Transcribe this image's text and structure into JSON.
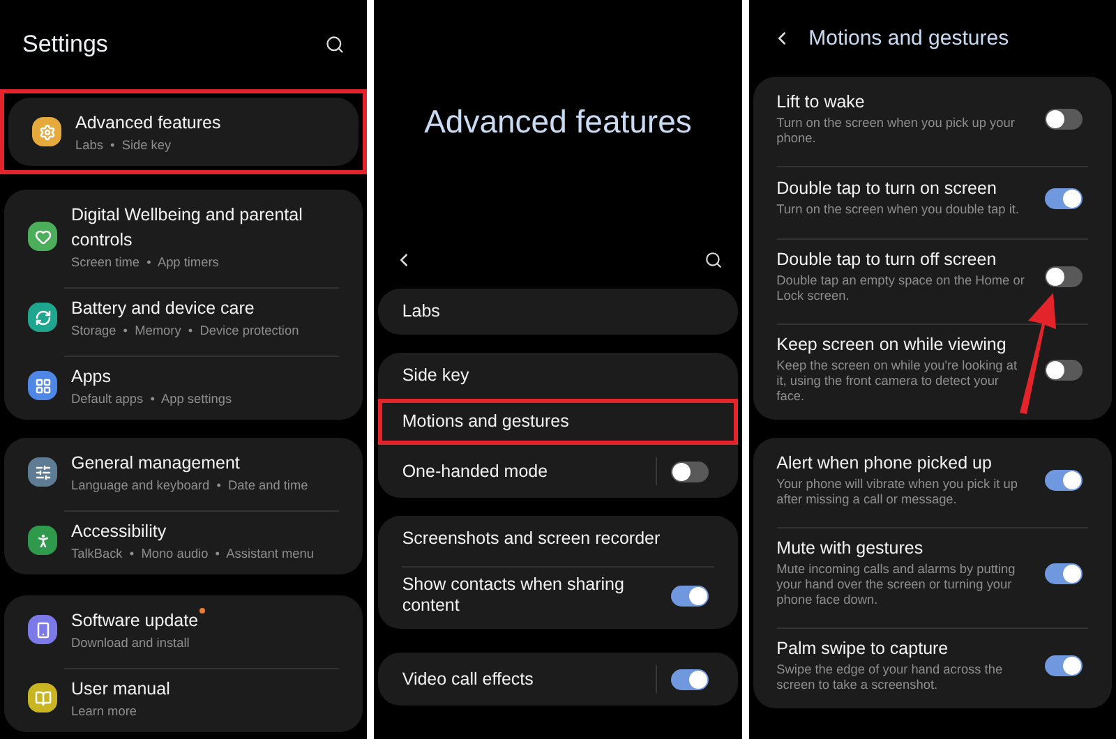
{
  "settings": {
    "title": "Settings",
    "groups": [
      [
        {
          "title": "Advanced features",
          "subtitle": "Labs  •  Side key",
          "color": "#e6a93c",
          "highlighted": true
        }
      ],
      [
        {
          "title": "Digital Wellbeing and parental controls",
          "subtitle": "Screen time  •  App timers",
          "color": "#4cae5b"
        },
        {
          "title": "Battery and device care",
          "subtitle": "Storage  •  Memory  •  Device protection",
          "color": "#1ea78e"
        },
        {
          "title": "Apps",
          "subtitle": "Default apps  •  App settings",
          "color": "#4f87e6"
        }
      ],
      [
        {
          "title": "General management",
          "subtitle": "Language and keyboard  •  Date and time",
          "color": "#5e7d94"
        },
        {
          "title": "Accessibility",
          "subtitle": "TalkBack  •  Mono audio  •  Assistant menu",
          "color": "#2f9a4c"
        }
      ],
      [
        {
          "title": "Software update",
          "subtitle": "Download and install",
          "color": "#7c79e8",
          "badge": true
        },
        {
          "title": "User manual",
          "subtitle": "Learn more",
          "color": "#c9b521"
        }
      ]
    ]
  },
  "advanced_features": {
    "title": "Advanced features",
    "groups": [
      [
        {
          "title": "Labs"
        }
      ],
      [
        {
          "title": "Side key"
        },
        {
          "title": "Motions and gestures",
          "highlighted": true
        },
        {
          "title": "One-handed mode",
          "on": false
        }
      ],
      [
        {
          "title": "Screenshots and screen recorder"
        },
        {
          "title": "Show contacts when sharing content",
          "on": true
        }
      ],
      [
        {
          "title": "Video call effects",
          "on": true
        }
      ]
    ]
  },
  "motions_and_gestures": {
    "title": "Motions and gestures",
    "groups": [
      [
        {
          "title": "Lift to wake",
          "subtitle": "Turn on the screen when you pick up your phone.",
          "on": false
        },
        {
          "title": "Double tap to turn on screen",
          "subtitle": "Turn on the screen when you double tap it.",
          "on": true
        },
        {
          "title": "Double tap to turn off screen",
          "subtitle": "Double tap an empty space on the Home or Lock screen.",
          "on": false,
          "pointer": true
        },
        {
          "title": "Keep screen on while viewing",
          "subtitle": "Keep the screen on while you're looking at it, using the front camera to detect your face.",
          "on": false
        }
      ],
      [
        {
          "title": "Alert when phone picked up",
          "subtitle": "Your phone will vibrate when you pick it up after missing a call or message.",
          "on": true
        },
        {
          "title": "Mute with gestures",
          "subtitle": "Mute incoming calls and alarms by putting your hand over the screen or turning your phone face down.",
          "on": true
        },
        {
          "title": "Palm swipe to capture",
          "subtitle": "Swipe the edge of your hand across the screen to take a screenshot.",
          "on": true
        }
      ]
    ]
  }
}
